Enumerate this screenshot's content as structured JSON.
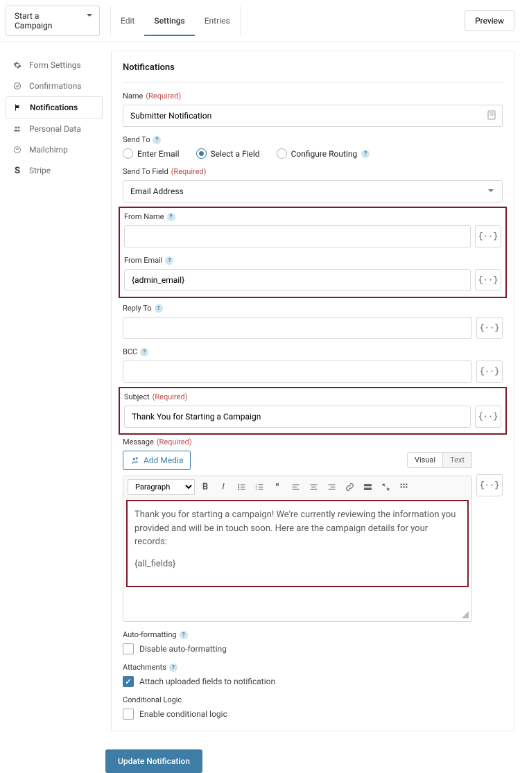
{
  "header": {
    "form_selector": "Start a Campaign",
    "tabs": [
      "Edit",
      "Settings",
      "Entries"
    ],
    "active_tab": "Settings",
    "preview": "Preview"
  },
  "sidebar": {
    "items": [
      {
        "label": "Form Settings",
        "icon": "gear"
      },
      {
        "label": "Confirmations",
        "icon": "check-circle"
      },
      {
        "label": "Notifications",
        "icon": "flag",
        "active": true
      },
      {
        "label": "Personal Data",
        "icon": "person"
      },
      {
        "label": "Mailchimp",
        "icon": "mailchimp"
      },
      {
        "label": "Stripe",
        "icon": "stripe"
      }
    ]
  },
  "panel": {
    "title": "Notifications",
    "required_label": "(Required)",
    "name": {
      "label": "Name",
      "value": "Submitter Notification"
    },
    "send_to": {
      "label": "Send To",
      "options": [
        "Enter Email",
        "Select a Field",
        "Configure Routing"
      ],
      "selected": "Select a Field"
    },
    "send_to_field": {
      "label": "Send To Field",
      "value": "Email Address"
    },
    "from_name": {
      "label": "From Name",
      "value": ""
    },
    "from_email": {
      "label": "From Email",
      "value": "{admin_email}"
    },
    "reply_to": {
      "label": "Reply To",
      "value": ""
    },
    "bcc": {
      "label": "BCC",
      "value": ""
    },
    "subject": {
      "label": "Subject",
      "value": "Thank You for Starting a Campaign"
    },
    "message": {
      "label": "Message",
      "add_media": "Add Media",
      "editor_tabs": [
        "Visual",
        "Text"
      ],
      "active_editor_tab": "Visual",
      "format_select": "Paragraph",
      "body_p1": "Thank you for starting a campaign! We're currently reviewing the information you provided and will be in touch soon. Here are the campaign details for your records:",
      "body_p2": "{all_fields}",
      "merge_token": "{··}"
    },
    "auto_formatting": {
      "label": "Auto-formatting",
      "check_label": "Disable auto-formatting",
      "checked": false
    },
    "attachments": {
      "label": "Attachments",
      "check_label": "Attach uploaded fields to notification",
      "checked": true
    },
    "conditional": {
      "label": "Conditional Logic",
      "check_label": "Enable conditional logic",
      "checked": false
    },
    "update_button": "Update Notification"
  }
}
